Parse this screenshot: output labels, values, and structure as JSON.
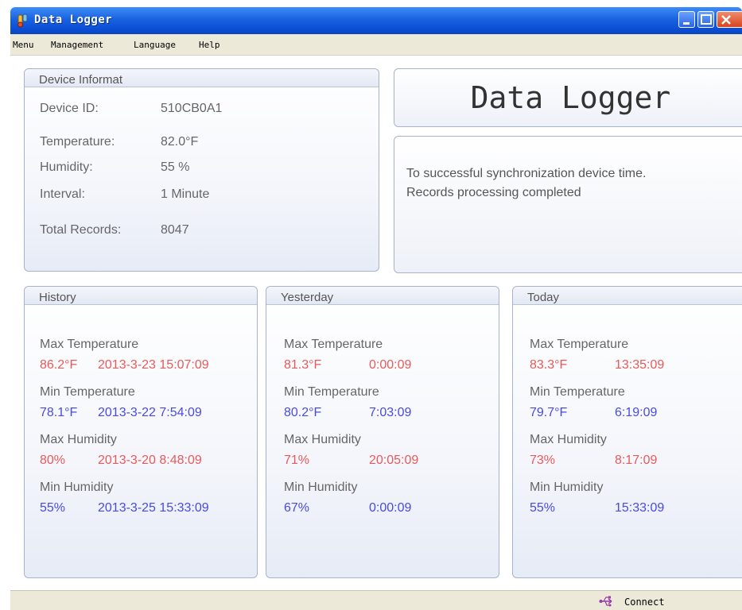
{
  "window": {
    "title": "Data Logger"
  },
  "menu": [
    "Menu",
    "Management",
    "Language",
    "Help"
  ],
  "device": {
    "title": "Device Informat",
    "rows": [
      {
        "label": "Device ID:",
        "value": "510CB0A1"
      },
      {
        "label": "Temperature:",
        "value": "82.0°F"
      },
      {
        "label": "Humidity:",
        "value": "55 %"
      },
      {
        "label": "Interval:",
        "value": "1 Minute"
      },
      {
        "label": "Total Records:",
        "value": "8047"
      }
    ]
  },
  "banner": {
    "text": "Data Logger"
  },
  "messages": [
    "To successful synchronization device time.",
    "Records processing completed"
  ],
  "stats": [
    {
      "title": "History",
      "max_temp": {
        "label": "Max Temperature",
        "value": "86.2°F",
        "time": "2013-3-23 15:07:09"
      },
      "min_temp": {
        "label": "Min Temperature",
        "value": "78.1°F",
        "time": "2013-3-22 7:54:09"
      },
      "max_hum": {
        "label": "Max Humidity",
        "value": "80%",
        "time": "2013-3-20 8:48:09"
      },
      "min_hum": {
        "label": "Min Humidity",
        "value": "55%",
        "time": "2013-3-25 15:33:09"
      }
    },
    {
      "title": "Yesterday",
      "max_temp": {
        "label": "Max Temperature",
        "value": "81.3°F",
        "time": "0:00:09"
      },
      "min_temp": {
        "label": "Min Temperature",
        "value": "80.2°F",
        "time": "7:03:09"
      },
      "max_hum": {
        "label": "Max Humidity",
        "value": "71%",
        "time": "20:05:09"
      },
      "min_hum": {
        "label": "Min Humidity",
        "value": "67%",
        "time": "0:00:09"
      }
    },
    {
      "title": "Today",
      "max_temp": {
        "label": "Max Temperature",
        "value": "83.3°F",
        "time": "13:35:09"
      },
      "min_temp": {
        "label": "Min Temperature",
        "value": "79.7°F",
        "time": "6:19:09"
      },
      "max_hum": {
        "label": "Max Humidity",
        "value": "73%",
        "time": "8:17:09"
      },
      "min_hum": {
        "label": "Min Humidity",
        "value": "55%",
        "time": "15:33:09"
      }
    }
  ],
  "status": {
    "text": "Connect",
    "icon": "usb-icon"
  },
  "colors": {
    "titlebar": "#1a62e0",
    "max_values": "#e85a5a",
    "min_values": "#4a4ae0"
  }
}
